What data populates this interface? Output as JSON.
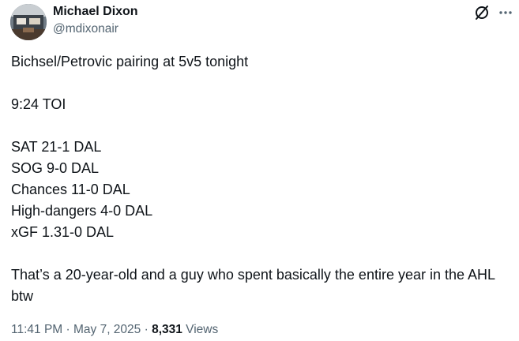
{
  "author": {
    "name": "Michael Dixon",
    "handle": "@mdixonair"
  },
  "icons": {
    "grok": "grok-icon",
    "more": "more-dots-icon"
  },
  "tweet": {
    "line1": "Bichsel/Petrovic pairing at 5v5 tonight",
    "toi": "9:24 TOI",
    "stats": [
      "SAT 21-1 DAL",
      "SOG 9-0 DAL",
      "Chances 11-0 DAL",
      "High-dangers 4-0 DAL",
      "xGF 1.31-0 DAL"
    ],
    "closing": "That’s a 20-year-old and a guy who spent basically the entire year in the AHL btw"
  },
  "meta": {
    "time": "11:41 PM",
    "separator1": " · ",
    "date": "May 7, 2025",
    "separator2": " · ",
    "views_count": "8,331",
    "views_label": " Views"
  },
  "colors": {
    "text": "#0f1419",
    "secondary": "#536471",
    "background": "#ffffff"
  }
}
